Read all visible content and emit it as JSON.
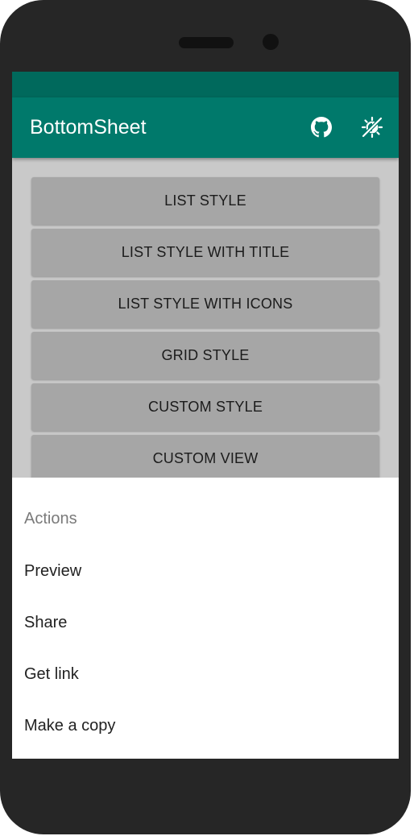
{
  "app_bar": {
    "title": "BottomSheet",
    "icons": [
      "github-icon",
      "theme-toggle-icon"
    ]
  },
  "colors": {
    "primary": "#00796b",
    "primary_dark": "#00695c",
    "scrim_background": "#c9c9c9",
    "button_background": "#a6a6a6",
    "device_body": "#262626"
  },
  "buttons": [
    {
      "label": "LIST STYLE"
    },
    {
      "label": "LIST STYLE WITH TITLE"
    },
    {
      "label": "LIST STYLE WITH ICONS"
    },
    {
      "label": "GRID STYLE"
    },
    {
      "label": "CUSTOM STYLE"
    },
    {
      "label": "CUSTOM VIEW"
    }
  ],
  "bottom_sheet": {
    "title": "Actions",
    "items": [
      {
        "label": "Preview"
      },
      {
        "label": "Share"
      },
      {
        "label": "Get link"
      },
      {
        "label": "Make a copy"
      }
    ]
  }
}
